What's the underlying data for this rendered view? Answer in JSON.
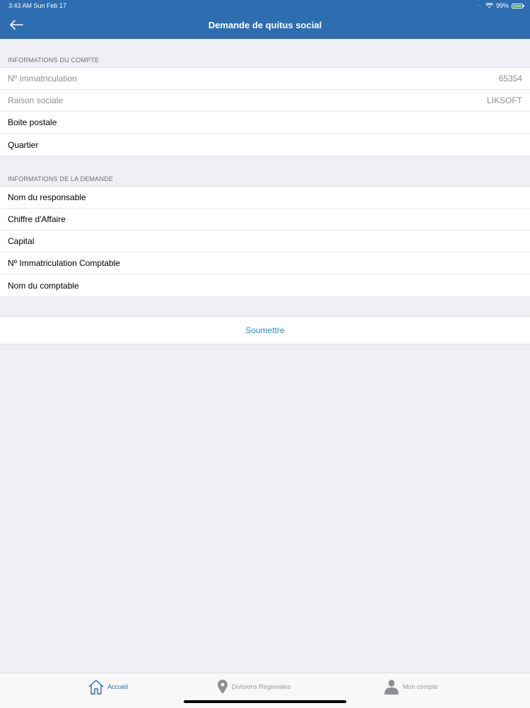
{
  "status_bar": {
    "time": "3:43 AM  Sun Feb 17",
    "battery": "99%",
    "battery_level": 0.99
  },
  "nav": {
    "title": "Demande de quitus social",
    "back_icon": "arrow-left-icon"
  },
  "account_section": {
    "header": "INFORMATIONS DU COMPTE",
    "rows": [
      {
        "label": "Nº Immatriculation",
        "value": "65354"
      },
      {
        "label": "Raison sociale",
        "value": "LIKSOFT"
      },
      {
        "label": "Boite postale",
        "value": ""
      },
      {
        "label": "Quartier",
        "value": ""
      }
    ]
  },
  "request_section": {
    "header": "INFORMATIONS DE LA DEMANDE",
    "rows": [
      {
        "label": "Nom du responsable"
      },
      {
        "label": "Chiffre d'Affaire"
      },
      {
        "label": "Capital"
      },
      {
        "label": "Nº Immatriculation Comptable"
      },
      {
        "label": "Nom du comptable"
      }
    ]
  },
  "submit": {
    "label": "Soumettre"
  },
  "tab_bar": {
    "items": [
      {
        "label": "Accueil",
        "icon": "home-icon",
        "active": true
      },
      {
        "label": "Divisions Régionales",
        "icon": "location-pin-icon",
        "active": false
      },
      {
        "label": "Mon compte",
        "icon": "user-icon",
        "active": false
      }
    ]
  },
  "colors": {
    "header": "#2d6db0",
    "accent": "#2f87d6",
    "background": "#efeff4"
  }
}
